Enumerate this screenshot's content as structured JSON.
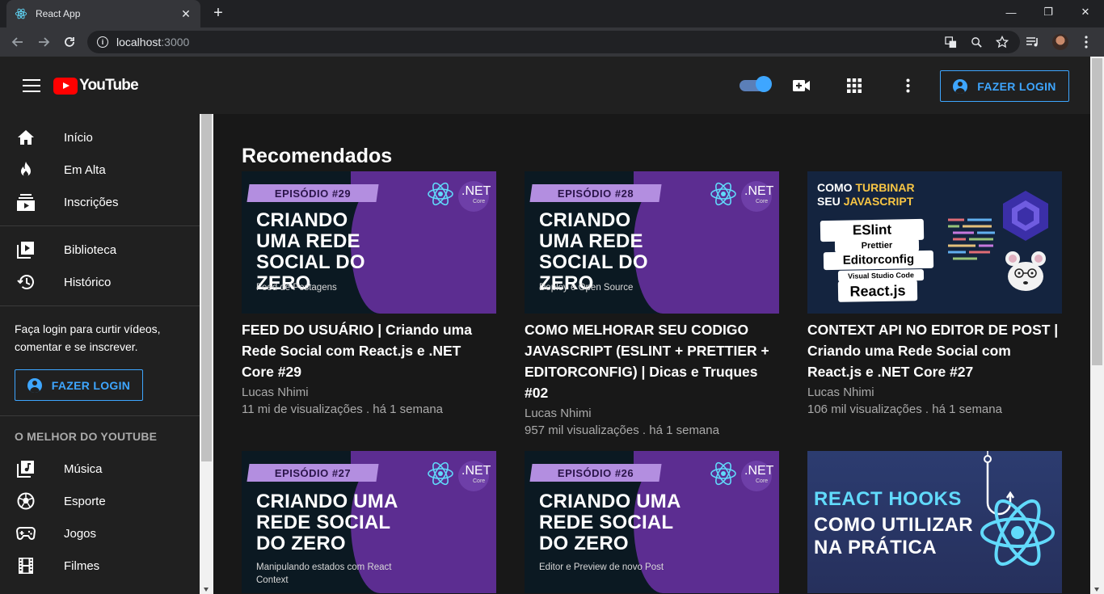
{
  "browser": {
    "tab_title": "React App",
    "tab_close": "✕",
    "new_tab": "+",
    "url_host": "localhost",
    "url_port": ":3000",
    "minimize": "—",
    "restore": "❐",
    "close": "✕"
  },
  "header": {
    "logo_text": "YouTube",
    "login_label": "FAZER LOGIN",
    "toggle_on": true,
    "accent_color": "#3ea6ff"
  },
  "sidebar": {
    "primary": [
      {
        "label": "Início",
        "icon": "home-icon"
      },
      {
        "label": "Em Alta",
        "icon": "fire-icon"
      },
      {
        "label": "Inscrições",
        "icon": "subscriptions-icon"
      }
    ],
    "library": [
      {
        "label": "Biblioteca",
        "icon": "library-icon"
      },
      {
        "label": "Histórico",
        "icon": "history-icon"
      }
    ],
    "login_prompt": "Faça login para curtir vídeos, comentar e se inscrever.",
    "login_label": "FAZER LOGIN",
    "best_heading": "O MELHOR DO YOUTUBE",
    "best": [
      {
        "label": "Música",
        "icon": "music-icon"
      },
      {
        "label": "Esporte",
        "icon": "sports-icon"
      },
      {
        "label": "Jogos",
        "icon": "gamepad-icon"
      },
      {
        "label": "Filmes",
        "icon": "film-icon"
      }
    ]
  },
  "main": {
    "section_title": "Recomendados",
    "videos": [
      {
        "title": "FEED DO USUÁRIO | Criando uma Rede Social com React.js e .NET Core #29",
        "channel": "Lucas Nhimi",
        "meta": "11 mi de visualizações . há 1 semana",
        "thumb": {
          "episode": "EPISÓDIO #29",
          "headline": "CRIANDO UMA REDE SOCIAL DO ZERO",
          "subtitle": "Feed de Postagens",
          "net": ".NET",
          "core": "Core"
        }
      },
      {
        "title": "COMO MELHORAR SEU CODIGO JAVASCRIPT (ESLINT + PRETTIER + EDITORCONFIG) | Dicas e Truques #02",
        "channel": "Lucas Nhimi",
        "meta": "957 mil visualizações . há 1 semana",
        "thumb": {
          "episode": "EPISÓDIO #28",
          "headline": "CRIANDO UMA REDE SOCIAL DO ZERO",
          "subtitle": "Deploy e Open Source",
          "net": ".NET",
          "core": "Core"
        }
      },
      {
        "title": "CONTEXT API NO EDITOR DE POST | Criando uma Rede Social com React.js e .NET Core #27",
        "channel": "Lucas Nhimi",
        "meta": "106 mil visualizações . há 1 semana",
        "thumb": {
          "line1a": "COMO ",
          "line1b": "TURBINAR",
          "line2a": "SEU ",
          "line2b": "JAVASCRIPT",
          "eslint": "ESlint",
          "prettier": "Prettier",
          "editorconfig": "Editorconfig",
          "vscode": "Visual Studio Code",
          "reactjs": "React.js"
        }
      },
      {
        "title": "",
        "channel": "",
        "meta": "",
        "thumb": {
          "episode": "EPISÓDIO #27",
          "headline": "CRIANDO UMA REDE SOCIAL DO ZERO",
          "subtitle": "Manipulando estados com React Context",
          "net": ".NET",
          "core": "Core"
        }
      },
      {
        "title": "",
        "channel": "",
        "meta": "",
        "thumb": {
          "episode": "EPISÓDIO #26",
          "headline": "CRIANDO UMA REDE SOCIAL DO ZERO",
          "subtitle": "Editor e Preview de novo Post",
          "net": ".NET",
          "core": "Core"
        }
      },
      {
        "title": "",
        "channel": "",
        "meta": "",
        "thumb": {
          "h1": "REACT HOOKS",
          "h2": "COMO UTILIZAR NA PRÁTICA"
        }
      }
    ]
  }
}
